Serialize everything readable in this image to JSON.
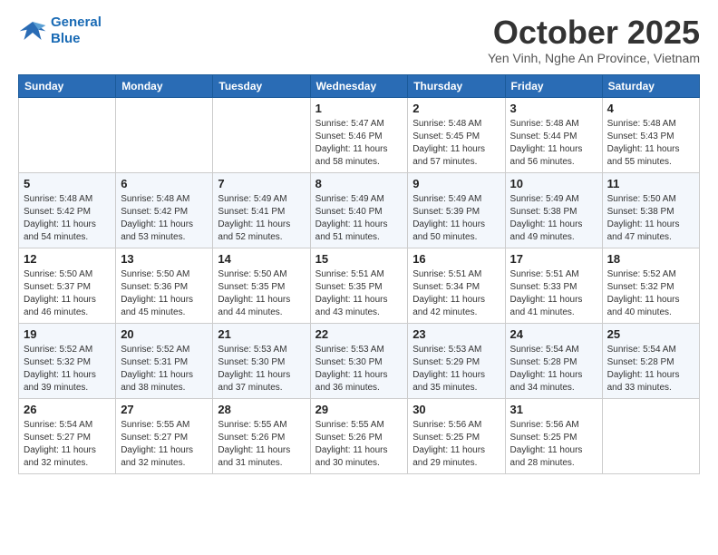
{
  "logo": {
    "line1": "General",
    "line2": "Blue"
  },
  "title": "October 2025",
  "subtitle": "Yen Vinh, Nghe An Province, Vietnam",
  "headers": [
    "Sunday",
    "Monday",
    "Tuesday",
    "Wednesday",
    "Thursday",
    "Friday",
    "Saturday"
  ],
  "weeks": [
    [
      {
        "day": "",
        "info": ""
      },
      {
        "day": "",
        "info": ""
      },
      {
        "day": "",
        "info": ""
      },
      {
        "day": "1",
        "info": "Sunrise: 5:47 AM\nSunset: 5:46 PM\nDaylight: 11 hours\nand 58 minutes."
      },
      {
        "day": "2",
        "info": "Sunrise: 5:48 AM\nSunset: 5:45 PM\nDaylight: 11 hours\nand 57 minutes."
      },
      {
        "day": "3",
        "info": "Sunrise: 5:48 AM\nSunset: 5:44 PM\nDaylight: 11 hours\nand 56 minutes."
      },
      {
        "day": "4",
        "info": "Sunrise: 5:48 AM\nSunset: 5:43 PM\nDaylight: 11 hours\nand 55 minutes."
      }
    ],
    [
      {
        "day": "5",
        "info": "Sunrise: 5:48 AM\nSunset: 5:42 PM\nDaylight: 11 hours\nand 54 minutes."
      },
      {
        "day": "6",
        "info": "Sunrise: 5:48 AM\nSunset: 5:42 PM\nDaylight: 11 hours\nand 53 minutes."
      },
      {
        "day": "7",
        "info": "Sunrise: 5:49 AM\nSunset: 5:41 PM\nDaylight: 11 hours\nand 52 minutes."
      },
      {
        "day": "8",
        "info": "Sunrise: 5:49 AM\nSunset: 5:40 PM\nDaylight: 11 hours\nand 51 minutes."
      },
      {
        "day": "9",
        "info": "Sunrise: 5:49 AM\nSunset: 5:39 PM\nDaylight: 11 hours\nand 50 minutes."
      },
      {
        "day": "10",
        "info": "Sunrise: 5:49 AM\nSunset: 5:38 PM\nDaylight: 11 hours\nand 49 minutes."
      },
      {
        "day": "11",
        "info": "Sunrise: 5:50 AM\nSunset: 5:38 PM\nDaylight: 11 hours\nand 47 minutes."
      }
    ],
    [
      {
        "day": "12",
        "info": "Sunrise: 5:50 AM\nSunset: 5:37 PM\nDaylight: 11 hours\nand 46 minutes."
      },
      {
        "day": "13",
        "info": "Sunrise: 5:50 AM\nSunset: 5:36 PM\nDaylight: 11 hours\nand 45 minutes."
      },
      {
        "day": "14",
        "info": "Sunrise: 5:50 AM\nSunset: 5:35 PM\nDaylight: 11 hours\nand 44 minutes."
      },
      {
        "day": "15",
        "info": "Sunrise: 5:51 AM\nSunset: 5:35 PM\nDaylight: 11 hours\nand 43 minutes."
      },
      {
        "day": "16",
        "info": "Sunrise: 5:51 AM\nSunset: 5:34 PM\nDaylight: 11 hours\nand 42 minutes."
      },
      {
        "day": "17",
        "info": "Sunrise: 5:51 AM\nSunset: 5:33 PM\nDaylight: 11 hours\nand 41 minutes."
      },
      {
        "day": "18",
        "info": "Sunrise: 5:52 AM\nSunset: 5:32 PM\nDaylight: 11 hours\nand 40 minutes."
      }
    ],
    [
      {
        "day": "19",
        "info": "Sunrise: 5:52 AM\nSunset: 5:32 PM\nDaylight: 11 hours\nand 39 minutes."
      },
      {
        "day": "20",
        "info": "Sunrise: 5:52 AM\nSunset: 5:31 PM\nDaylight: 11 hours\nand 38 minutes."
      },
      {
        "day": "21",
        "info": "Sunrise: 5:53 AM\nSunset: 5:30 PM\nDaylight: 11 hours\nand 37 minutes."
      },
      {
        "day": "22",
        "info": "Sunrise: 5:53 AM\nSunset: 5:30 PM\nDaylight: 11 hours\nand 36 minutes."
      },
      {
        "day": "23",
        "info": "Sunrise: 5:53 AM\nSunset: 5:29 PM\nDaylight: 11 hours\nand 35 minutes."
      },
      {
        "day": "24",
        "info": "Sunrise: 5:54 AM\nSunset: 5:28 PM\nDaylight: 11 hours\nand 34 minutes."
      },
      {
        "day": "25",
        "info": "Sunrise: 5:54 AM\nSunset: 5:28 PM\nDaylight: 11 hours\nand 33 minutes."
      }
    ],
    [
      {
        "day": "26",
        "info": "Sunrise: 5:54 AM\nSunset: 5:27 PM\nDaylight: 11 hours\nand 32 minutes."
      },
      {
        "day": "27",
        "info": "Sunrise: 5:55 AM\nSunset: 5:27 PM\nDaylight: 11 hours\nand 32 minutes."
      },
      {
        "day": "28",
        "info": "Sunrise: 5:55 AM\nSunset: 5:26 PM\nDaylight: 11 hours\nand 31 minutes."
      },
      {
        "day": "29",
        "info": "Sunrise: 5:55 AM\nSunset: 5:26 PM\nDaylight: 11 hours\nand 30 minutes."
      },
      {
        "day": "30",
        "info": "Sunrise: 5:56 AM\nSunset: 5:25 PM\nDaylight: 11 hours\nand 29 minutes."
      },
      {
        "day": "31",
        "info": "Sunrise: 5:56 AM\nSunset: 5:25 PM\nDaylight: 11 hours\nand 28 minutes."
      },
      {
        "day": "",
        "info": ""
      }
    ]
  ]
}
